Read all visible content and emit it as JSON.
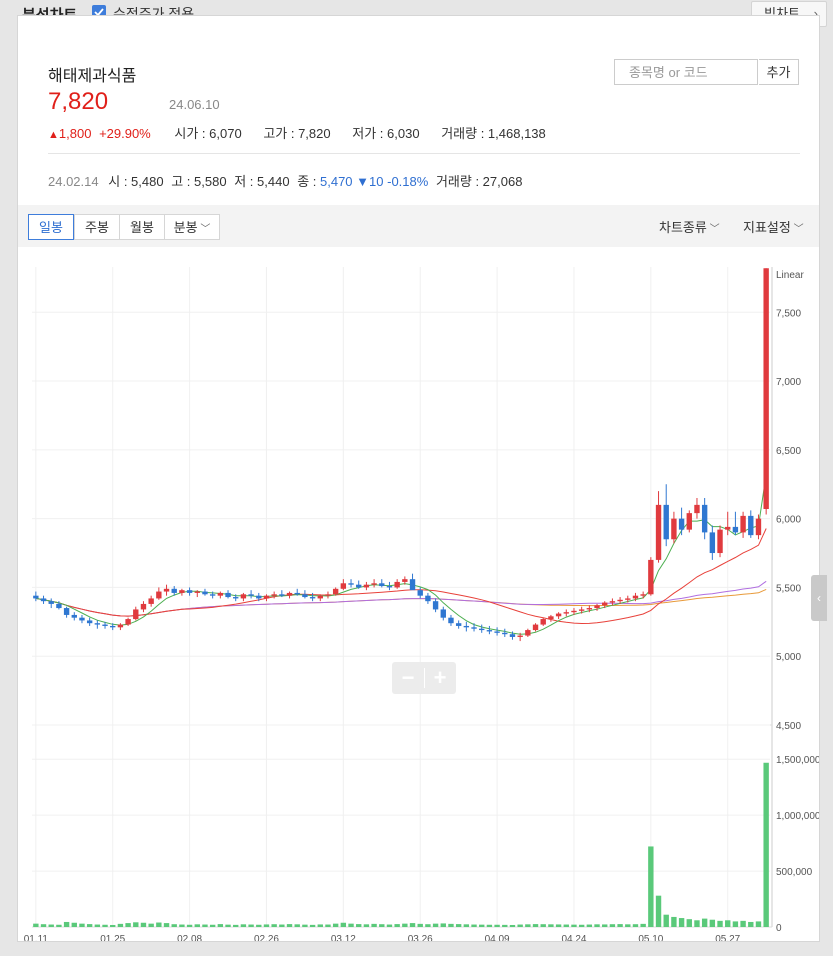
{
  "topbar": {
    "title": "분석차트",
    "adjusted_label": "수정주가 적용",
    "adjusted_checked": true,
    "big_chart_label": "빅차트"
  },
  "stock": {
    "name": "해태제과식품",
    "price": "7,820",
    "date": "24.06.10",
    "change_arrow": "▲",
    "change": "1,800",
    "change_pct": "+29.90%",
    "open_label": "시가",
    "open": "6,070",
    "high_label": "고가",
    "high": "7,820",
    "low_label": "저가",
    "low": "6,030",
    "volume_label": "거래량",
    "volume": "1,468,138"
  },
  "search": {
    "placeholder": "종목명 or 코드",
    "add_label": "추가"
  },
  "history": {
    "date": "24.02.14",
    "open_label": "시",
    "open": "5,480",
    "high_label": "고",
    "high": "5,580",
    "low_label": "저",
    "low": "5,440",
    "close_label": "종",
    "close": "5,470",
    "change": "▼10 -0.18%",
    "volume_label": "거래량",
    "volume": "27,068"
  },
  "toolbar": {
    "tabs": [
      "일봉",
      "주봉",
      "월봉",
      "분봉"
    ],
    "active_tab": "일봉",
    "chart_type_label": "차트종류",
    "indicator_label": "지표설정"
  },
  "colors": {
    "up": "#e03a3e",
    "down": "#2f77d1",
    "volume": "#5ac97a",
    "ma5": "#4caf50",
    "ma20": "#e8413a",
    "ma60": "#b06ee0",
    "ma120": "#e89a3a"
  },
  "chart_data": {
    "type": "candlestick",
    "scale_label": "Linear",
    "price_axis": {
      "ylim": [
        4500,
        7800
      ],
      "ticks": [
        7500,
        7000,
        6500,
        6000,
        5500,
        5000,
        4500
      ],
      "tick_labels": [
        "7,500",
        "7,000",
        "6,500",
        "6,000",
        "5,500",
        "5,000",
        "4,500"
      ]
    },
    "volume_axis": {
      "ylim": [
        0,
        1600000
      ],
      "ticks": [
        1500000,
        1000000,
        500000,
        0
      ],
      "tick_labels": [
        "1,500,000",
        "1,000,000",
        "500,000",
        "0"
      ]
    },
    "x_labels": [
      "01.11",
      "01.25",
      "02.08",
      "02.26",
      "03.12",
      "03.26",
      "04.09",
      "04.24",
      "05.10",
      "05.27"
    ],
    "x_label_index": [
      0,
      10,
      20,
      30,
      40,
      50,
      60,
      70,
      80,
      90
    ],
    "candles": [
      [
        5440,
        5470,
        5400,
        5420
      ],
      [
        5420,
        5440,
        5380,
        5400
      ],
      [
        5400,
        5420,
        5350,
        5380
      ],
      [
        5380,
        5400,
        5340,
        5350
      ],
      [
        5350,
        5360,
        5280,
        5300
      ],
      [
        5300,
        5320,
        5260,
        5280
      ],
      [
        5280,
        5300,
        5240,
        5260
      ],
      [
        5260,
        5280,
        5220,
        5240
      ],
      [
        5240,
        5260,
        5200,
        5230
      ],
      [
        5230,
        5250,
        5200,
        5220
      ],
      [
        5220,
        5240,
        5190,
        5210
      ],
      [
        5210,
        5240,
        5190,
        5230
      ],
      [
        5230,
        5280,
        5220,
        5270
      ],
      [
        5270,
        5360,
        5260,
        5340
      ],
      [
        5340,
        5400,
        5320,
        5380
      ],
      [
        5380,
        5440,
        5360,
        5420
      ],
      [
        5420,
        5500,
        5410,
        5470
      ],
      [
        5470,
        5520,
        5440,
        5490
      ],
      [
        5490,
        5510,
        5440,
        5460
      ],
      [
        5460,
        5490,
        5440,
        5480
      ],
      [
        5480,
        5500,
        5440,
        5460
      ],
      [
        5460,
        5480,
        5430,
        5470
      ],
      [
        5470,
        5490,
        5440,
        5450
      ],
      [
        5450,
        5470,
        5420,
        5440
      ],
      [
        5440,
        5470,
        5420,
        5460
      ],
      [
        5460,
        5480,
        5420,
        5430
      ],
      [
        5430,
        5450,
        5400,
        5420
      ],
      [
        5420,
        5460,
        5400,
        5450
      ],
      [
        5450,
        5480,
        5420,
        5440
      ],
      [
        5440,
        5460,
        5400,
        5420
      ],
      [
        5420,
        5450,
        5400,
        5440
      ],
      [
        5440,
        5470,
        5420,
        5450
      ],
      [
        5450,
        5480,
        5430,
        5440
      ],
      [
        5440,
        5470,
        5420,
        5460
      ],
      [
        5460,
        5490,
        5440,
        5450
      ],
      [
        5450,
        5480,
        5420,
        5430
      ],
      [
        5430,
        5460,
        5400,
        5420
      ],
      [
        5420,
        5450,
        5400,
        5440
      ],
      [
        5440,
        5470,
        5420,
        5450
      ],
      [
        5450,
        5500,
        5440,
        5490
      ],
      [
        5490,
        5560,
        5480,
        5530
      ],
      [
        5530,
        5560,
        5500,
        5520
      ],
      [
        5520,
        5550,
        5490,
        5500
      ],
      [
        5500,
        5540,
        5480,
        5520
      ],
      [
        5520,
        5560,
        5500,
        5530
      ],
      [
        5530,
        5560,
        5500,
        5510
      ],
      [
        5510,
        5540,
        5480,
        5500
      ],
      [
        5500,
        5560,
        5490,
        5540
      ],
      [
        5540,
        5580,
        5520,
        5560
      ],
      [
        5560,
        5600,
        5530,
        5480
      ],
      [
        5480,
        5500,
        5420,
        5440
      ],
      [
        5440,
        5460,
        5380,
        5400
      ],
      [
        5400,
        5420,
        5320,
        5340
      ],
      [
        5340,
        5360,
        5260,
        5280
      ],
      [
        5280,
        5300,
        5220,
        5240
      ],
      [
        5240,
        5260,
        5200,
        5220
      ],
      [
        5220,
        5250,
        5180,
        5210
      ],
      [
        5210,
        5240,
        5180,
        5200
      ],
      [
        5200,
        5230,
        5170,
        5190
      ],
      [
        5190,
        5220,
        5160,
        5180
      ],
      [
        5180,
        5210,
        5150,
        5170
      ],
      [
        5170,
        5200,
        5140,
        5160
      ],
      [
        5160,
        5180,
        5120,
        5140
      ],
      [
        5140,
        5170,
        5110,
        5150
      ],
      [
        5150,
        5200,
        5140,
        5190
      ],
      [
        5190,
        5240,
        5180,
        5230
      ],
      [
        5230,
        5280,
        5220,
        5270
      ],
      [
        5270,
        5300,
        5250,
        5290
      ],
      [
        5290,
        5320,
        5270,
        5310
      ],
      [
        5310,
        5340,
        5290,
        5320
      ],
      [
        5320,
        5350,
        5300,
        5330
      ],
      [
        5330,
        5360,
        5310,
        5340
      ],
      [
        5340,
        5370,
        5320,
        5350
      ],
      [
        5350,
        5380,
        5330,
        5370
      ],
      [
        5370,
        5400,
        5350,
        5390
      ],
      [
        5390,
        5420,
        5370,
        5400
      ],
      [
        5400,
        5430,
        5380,
        5410
      ],
      [
        5410,
        5440,
        5390,
        5420
      ],
      [
        5420,
        5460,
        5400,
        5440
      ],
      [
        5440,
        5470,
        5420,
        5450
      ],
      [
        5450,
        5720,
        5440,
        5700
      ],
      [
        5700,
        6200,
        5680,
        6100
      ],
      [
        6100,
        6250,
        5800,
        5850
      ],
      [
        5850,
        6050,
        5820,
        6000
      ],
      [
        6000,
        6080,
        5880,
        5920
      ],
      [
        5920,
        6060,
        5900,
        6040
      ],
      [
        6040,
        6150,
        6000,
        6100
      ],
      [
        6100,
        6150,
        5850,
        5900
      ],
      [
        5900,
        5950,
        5700,
        5750
      ],
      [
        5750,
        5950,
        5720,
        5920
      ],
      [
        5920,
        6050,
        5880,
        5940
      ],
      [
        5940,
        6050,
        5880,
        5900
      ],
      [
        5900,
        6050,
        5860,
        6020
      ],
      [
        6020,
        6060,
        5860,
        5880
      ],
      [
        5880,
        6030,
        5850,
        6000
      ],
      [
        6070,
        7820,
        6030,
        7820
      ]
    ],
    "volume": [
      30000,
      25000,
      22000,
      20000,
      45000,
      38000,
      30000,
      26000,
      22000,
      20000,
      18000,
      28000,
      35000,
      42000,
      38000,
      30000,
      40000,
      35000,
      25000,
      22000,
      20000,
      24000,
      22000,
      20000,
      26000,
      21000,
      19000,
      24000,
      22000,
      20000,
      23000,
      25000,
      22000,
      26000,
      24000,
      21000,
      19000,
      23000,
      22000,
      30000,
      38000,
      30000,
      26000,
      24000,
      28000,
      25000,
      22000,
      26000,
      30000,
      35000,
      28000,
      25000,
      30000,
      32000,
      28000,
      26000,
      24000,
      22000,
      21000,
      20000,
      20000,
      19000,
      18000,
      22000,
      24000,
      26000,
      25000,
      24000,
      23000,
      22000,
      21000,
      20000,
      22000,
      24000,
      23000,
      25000,
      26000,
      24000,
      25000,
      28000,
      720000,
      280000,
      110000,
      90000,
      80000,
      70000,
      60000,
      75000,
      65000,
      55000,
      60000,
      50000,
      55000,
      45000,
      50000,
      1468138
    ]
  }
}
